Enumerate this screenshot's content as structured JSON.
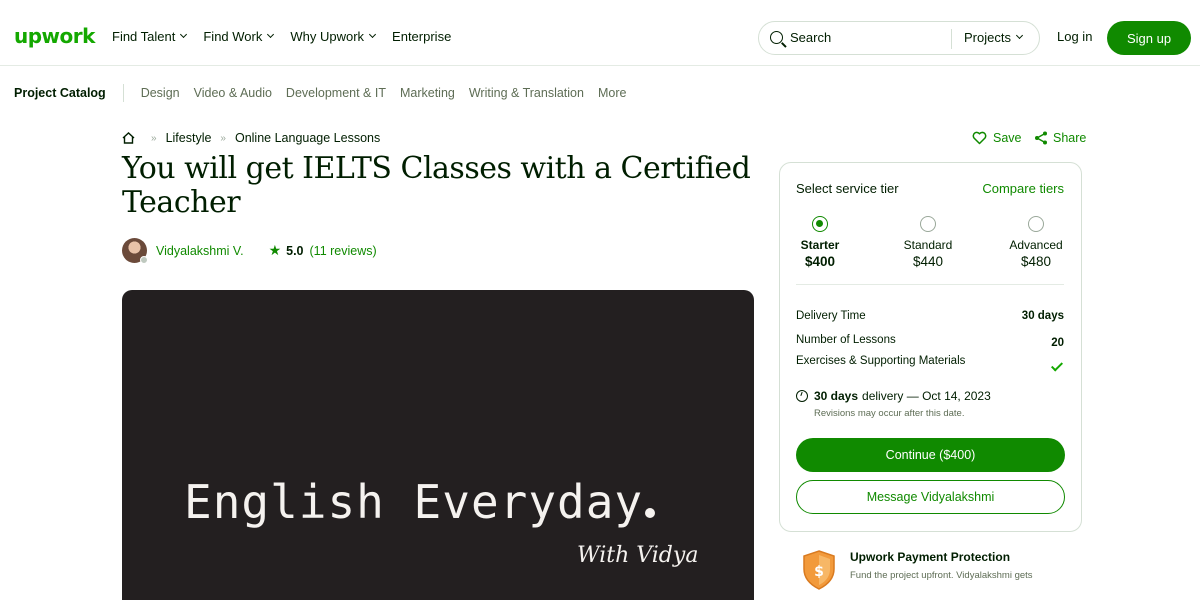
{
  "header": {
    "logo": "upwork",
    "nav": [
      "Find Talent",
      "Find Work",
      "Why Upwork",
      "Enterprise"
    ],
    "search_placeholder": "Search",
    "search_scope": "Projects",
    "login": "Log in",
    "signup": "Sign up"
  },
  "subnav": {
    "catalog": "Project Catalog",
    "categories": [
      "Design",
      "Video & Audio",
      "Development & IT",
      "Marketing",
      "Writing & Translation",
      "More"
    ]
  },
  "breadcrumb": [
    "Lifestyle",
    "Online Language Lessons"
  ],
  "project": {
    "title": "You will get IELTS Classes with a Certified Teacher",
    "seller": "Vidyalakshmi V.",
    "rating": "5.0",
    "reviews": "(11 reviews)",
    "gallery_title": "English Everyday",
    "gallery_subtitle": "With Vidya"
  },
  "actions": {
    "save": "Save",
    "share": "Share"
  },
  "card": {
    "heading": "Select service tier",
    "compare": "Compare tiers",
    "tiers": [
      {
        "name": "Starter",
        "price": "$400",
        "selected": true
      },
      {
        "name": "Standard",
        "price": "$440",
        "selected": false
      },
      {
        "name": "Advanced",
        "price": "$480",
        "selected": false
      }
    ],
    "specs": {
      "delivery_label": "Delivery Time",
      "delivery_value": "30 days",
      "lessons_label": "Number of Lessons",
      "lessons_value": "20",
      "materials_label": "Exercises & Supporting Materials"
    },
    "delivery_bold": "30 days",
    "delivery_rest": "delivery — Oct 14, 2023",
    "revisions_note": "Revisions may occur after this date.",
    "continue": "Continue ($400)",
    "message": "Message Vidyalakshmi"
  },
  "protection": {
    "title": "Upwork Payment Protection",
    "text": "Fund the project upfront. Vidyalakshmi gets"
  },
  "colors": {
    "brand_green": "#108a00",
    "logo_green": "#14a800",
    "gallery_bg": "#231f20"
  }
}
